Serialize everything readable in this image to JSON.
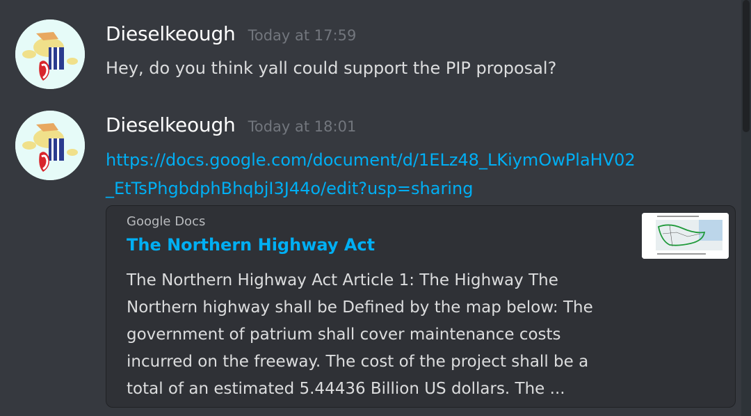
{
  "messages": [
    {
      "username": "Dieselkeough",
      "timestamp": "Today at 17:59",
      "text": "Hey, do you think yall could support the PIP proposal?",
      "avatar_icon": "pony-avatar"
    },
    {
      "username": "Dieselkeough",
      "timestamp": "Today at 18:01",
      "link_lines": [
        "https://docs.google.com/document/d/1ELz48_LKiymOwPlaHV02",
        "_EtTsPhgbdphBhqbjI3J44o/edit?usp=sharing"
      ],
      "avatar_icon": "pony-avatar",
      "embed": {
        "provider": "Google Docs",
        "title": "The Northern Highway Act",
        "description_lines": [
          "The Northern Highway Act   Article 1: The Highway   The",
          "Northern highway shall be Defined by the map below:   The",
          "government of patrium shall cover maintenance costs",
          "incurred on the freeway. The cost of the project shall be a",
          "total of an estimated 5.44436 Billion US dollars. The ..."
        ],
        "thumbnail_icon": "map-thumbnail"
      }
    }
  ],
  "colors": {
    "background": "#36393f",
    "embed_background": "#2f3136",
    "link": "#00aff4",
    "username": "#ffffff",
    "timestamp": "#72767d",
    "text": "#dcddde"
  }
}
